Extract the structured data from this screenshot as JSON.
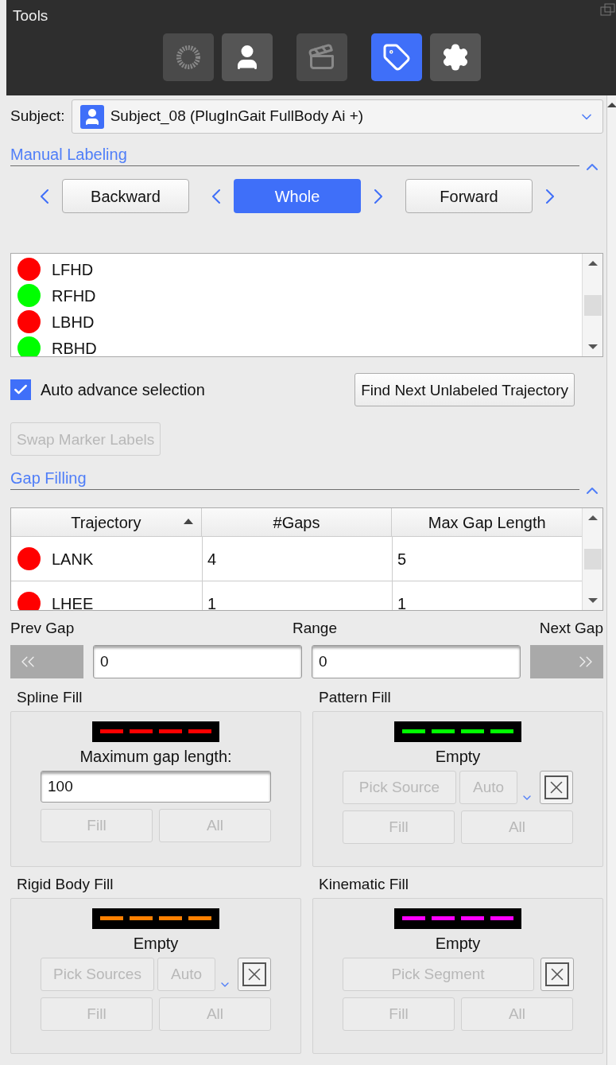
{
  "window": {
    "title": "Tools"
  },
  "toolbar": [
    {
      "kind": "markers",
      "selected": false,
      "disabled": true
    },
    {
      "kind": "subject",
      "selected": false,
      "disabled": false
    },
    {
      "kind": "clapper",
      "selected": false,
      "disabled": true
    },
    {
      "kind": "tag",
      "selected": true,
      "disabled": false
    },
    {
      "kind": "settings",
      "selected": false,
      "disabled": false
    }
  ],
  "subject": {
    "label": "Subject:",
    "value": "Subject_08 (PlugInGait FullBody Ai +)"
  },
  "manual_labeling": {
    "title": "Manual Labeling",
    "expanded": true,
    "modes": [
      {
        "label": "Backward",
        "selected": false
      },
      {
        "label": "Whole",
        "selected": true
      },
      {
        "label": "Forward",
        "selected": false
      }
    ],
    "markers": [
      {
        "name": "LFHD",
        "color": "#ff0000"
      },
      {
        "name": "RFHD",
        "color": "#00ff00"
      },
      {
        "name": "LBHD",
        "color": "#ff0000"
      },
      {
        "name": "RBHD",
        "color": "#00ff00"
      }
    ],
    "auto_advance": {
      "label": "Auto advance selection",
      "checked": true
    },
    "find_button": {
      "label": "Find Next Unlabeled Trajectory",
      "disabled": false
    },
    "swap_button": {
      "label": "Swap Marker Labels",
      "disabled": true
    }
  },
  "gap_filling": {
    "title": "Gap Filling",
    "expanded": true,
    "table": {
      "columns": [
        {
          "label": "Trajectory",
          "sorted": true
        },
        {
          "label": "#Gaps",
          "sorted": false
        },
        {
          "label": "Max Gap Length",
          "sorted": false
        }
      ],
      "rows": [
        {
          "trajectory": "LANK",
          "color": "#ff0000",
          "gaps": "4",
          "max_gap_length": "5"
        },
        {
          "trajectory": "LHEE",
          "color": "#ff0000",
          "gaps": "1",
          "max_gap_length": "1"
        }
      ]
    },
    "prev_gap": {
      "label": "Prev Gap",
      "disabled": true
    },
    "range": {
      "label": "Range",
      "from": "0",
      "to": "0"
    },
    "next_gap": {
      "label": "Next Gap",
      "disabled": true
    },
    "panels": [
      {
        "kind": "spline",
        "title": "Spline Fill",
        "color": "#ff0000",
        "caption": "Maximum gap length:",
        "value": "100",
        "buttons": [
          {
            "label": "Fill",
            "disabled": true
          },
          {
            "label": "All",
            "disabled": true
          }
        ]
      },
      {
        "kind": "sources",
        "title": "Pattern Fill",
        "color": "#00ff00",
        "caption": "Empty",
        "pick": {
          "label": "Pick Source",
          "disabled": true
        },
        "auto": {
          "label": "Auto",
          "disabled": true
        },
        "buttons": [
          {
            "label": "Fill",
            "disabled": true
          },
          {
            "label": "All",
            "disabled": true
          }
        ]
      },
      {
        "kind": "sources",
        "title": "Rigid Body Fill",
        "color": "#ff8000",
        "caption": "Empty",
        "pick": {
          "label": "Pick Sources",
          "disabled": true
        },
        "auto": {
          "label": "Auto",
          "disabled": true
        },
        "buttons": [
          {
            "label": "Fill",
            "disabled": true
          },
          {
            "label": "All",
            "disabled": true
          }
        ]
      },
      {
        "kind": "segment",
        "title": "Kinematic Fill",
        "color": "#ff00ff",
        "caption": "Empty",
        "pick": {
          "label": "Pick Segment",
          "disabled": true
        },
        "buttons": [
          {
            "label": "Fill",
            "disabled": true
          },
          {
            "label": "All",
            "disabled": true
          }
        ]
      }
    ]
  }
}
